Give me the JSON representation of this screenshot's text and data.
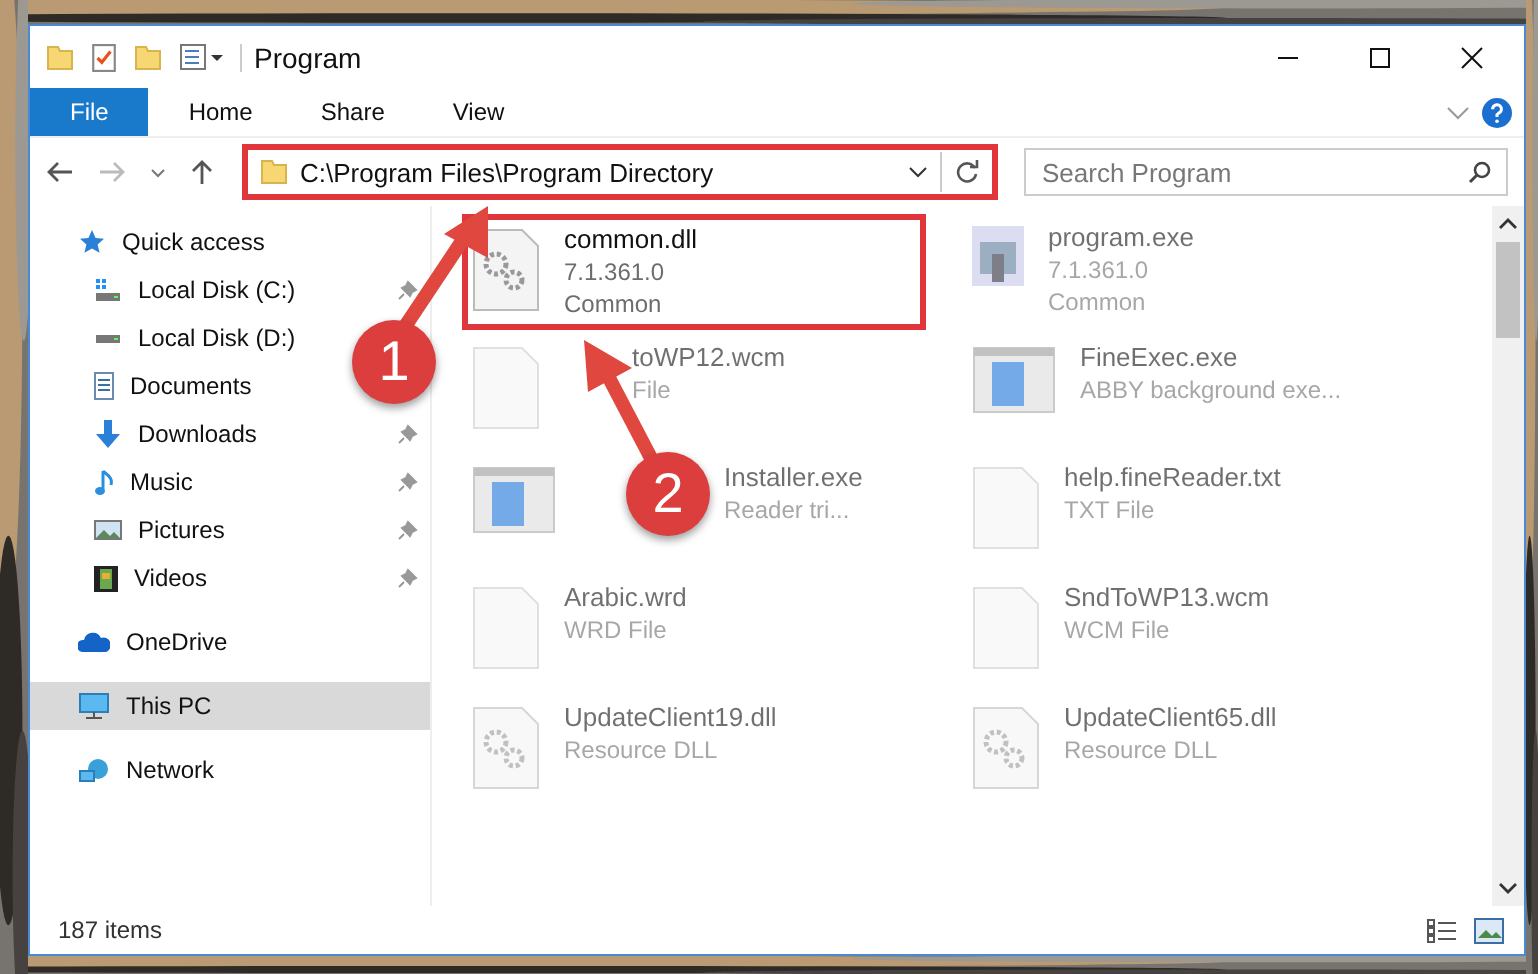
{
  "window": {
    "title": "Program"
  },
  "ribbon_tabs": [
    {
      "label": "File",
      "selected": true
    },
    {
      "label": "Home",
      "selected": false
    },
    {
      "label": "Share",
      "selected": false
    },
    {
      "label": "View",
      "selected": false
    }
  ],
  "address": {
    "path": "C:\\Program Files\\Program Directory",
    "highlighted": true
  },
  "search": {
    "placeholder": "Search Program"
  },
  "sidebar": {
    "items": [
      {
        "label": "Quick access",
        "kind": "star",
        "selected": false,
        "children": [
          {
            "label": "Local Disk (C:)",
            "kind": "drive-sys",
            "pinned": true
          },
          {
            "label": "Local Disk (D:)",
            "kind": "drive",
            "pinned": false
          },
          {
            "label": "Documents",
            "kind": "doc",
            "pinned": false
          },
          {
            "label": "Downloads",
            "kind": "download",
            "pinned": true
          },
          {
            "label": "Music",
            "kind": "music",
            "pinned": true
          },
          {
            "label": "Pictures",
            "kind": "pictures",
            "pinned": true
          },
          {
            "label": "Videos",
            "kind": "videos",
            "pinned": true
          }
        ]
      },
      {
        "label": "OneDrive",
        "kind": "cloud",
        "selected": false
      },
      {
        "label": "This PC",
        "kind": "pc",
        "selected": true
      },
      {
        "label": "Network",
        "kind": "network",
        "selected": false
      }
    ]
  },
  "files": [
    {
      "name": "common.dll",
      "lines": [
        "7.1.361.0",
        "Common"
      ],
      "kind": "dll",
      "blurred": false,
      "highlighted": true
    },
    {
      "name": "program.exe",
      "lines": [
        "7.1.361.0",
        "Common"
      ],
      "kind": "exe",
      "blurred": true,
      "highlighted": false
    },
    {
      "name": "toWP12.wcm",
      "lines": [
        "File"
      ],
      "kind": "blank",
      "blurred": true,
      "highlighted": false
    },
    {
      "name": "FineExec.exe",
      "lines": [
        "ABBY background exe..."
      ],
      "kind": "app",
      "blurred": true,
      "highlighted": false
    },
    {
      "name": "Installer.exe",
      "lines": [
        "Reader tri..."
      ],
      "kind": "app",
      "blurred": true,
      "highlighted": false
    },
    {
      "name": "help.fineReader.txt",
      "lines": [
        "TXT File"
      ],
      "kind": "blank",
      "blurred": true,
      "highlighted": false
    },
    {
      "name": "Arabic.wrd",
      "lines": [
        "WRD File"
      ],
      "kind": "blank",
      "blurred": true,
      "highlighted": false
    },
    {
      "name": "SndToWP13.wcm",
      "lines": [
        "WCM File"
      ],
      "kind": "blank",
      "blurred": true,
      "highlighted": false
    },
    {
      "name": "UpdateClient19.dll",
      "lines": [
        "Resource DLL"
      ],
      "kind": "dll",
      "blurred": true,
      "highlighted": false
    },
    {
      "name": "UpdateClient65.dll",
      "lines": [
        "Resource DLL"
      ],
      "kind": "dll",
      "blurred": true,
      "highlighted": false
    }
  ],
  "status_bar": {
    "count": "187 items"
  },
  "callouts": [
    {
      "number": "1"
    },
    {
      "number": "2"
    }
  ]
}
